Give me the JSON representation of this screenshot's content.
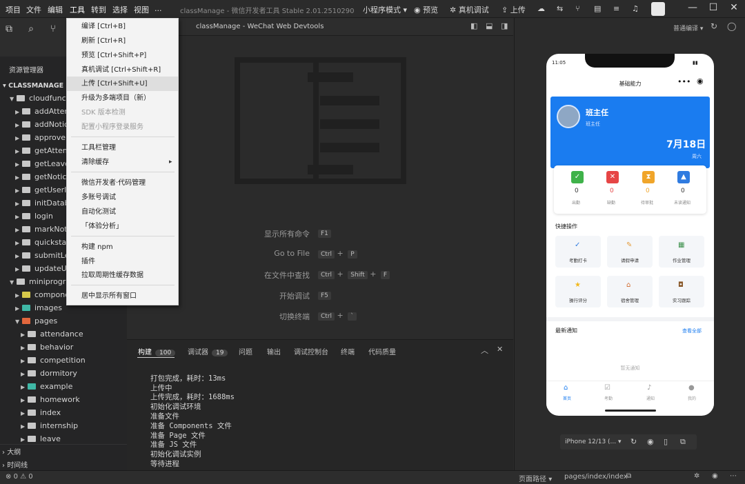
{
  "menubar": {
    "items": [
      "项目",
      "文件",
      "编辑",
      "工具",
      "转到",
      "选择",
      "视图",
      "..."
    ],
    "window_title": "classManage - 微信开发者工具 Stable 2.01.2510290"
  },
  "toolbar": {
    "mode": "小程序模式",
    "preview": "预览",
    "real_debug": "真机调试",
    "upload": "上传"
  },
  "dropdown": {
    "items": [
      {
        "label": "编译  [Ctrl+B]"
      },
      {
        "label": "刷新  [Ctrl+R]"
      },
      {
        "label": "预览  [Ctrl+Shift+P]"
      },
      {
        "label": "真机调试  [Ctrl+Shift+R]"
      },
      {
        "label": "上传  [Ctrl+Shift+U]"
      },
      {
        "label": "升级为多端项目（新）"
      },
      {
        "label": "SDK 版本检测"
      },
      {
        "label": "配置小程序登录服务"
      },
      {
        "label": "工具栏管理"
      },
      {
        "label": "清除缓存"
      },
      {
        "label": "微信开发者·代码管理"
      },
      {
        "label": "多账号调试"
      },
      {
        "label": "自动化测试"
      },
      {
        "label": "「体验分析」"
      },
      {
        "label": "构建 npm"
      },
      {
        "label": "插件"
      },
      {
        "label": "拉取周期性缓存数据"
      },
      {
        "label": "居中显示所有窗口"
      }
    ],
    "submenu_arrow": "▸"
  },
  "explorer": {
    "title": "资源管理器",
    "root": "CLASSMANAGE",
    "rows": [
      {
        "label": "cloudfunct"
      },
      {
        "label": "addAtten"
      },
      {
        "label": "addNotic"
      },
      {
        "label": "approveL"
      },
      {
        "label": "getAtten"
      },
      {
        "label": "getLeave"
      },
      {
        "label": "getNotic"
      },
      {
        "label": "getUserIn"
      },
      {
        "label": "initDatab"
      },
      {
        "label": "login"
      },
      {
        "label": "markNot"
      },
      {
        "label": "quickstar"
      },
      {
        "label": "submitLe"
      },
      {
        "label": "updateUs"
      },
      {
        "label": "miniprogra"
      },
      {
        "label": "compone"
      },
      {
        "label": "images"
      },
      {
        "label": "pages"
      },
      {
        "label": "attendance"
      },
      {
        "label": "behavior"
      },
      {
        "label": "competition"
      },
      {
        "label": "dormitory"
      },
      {
        "label": "example"
      },
      {
        "label": "homework"
      },
      {
        "label": "index"
      },
      {
        "label": "internship"
      },
      {
        "label": "leave"
      }
    ],
    "outline": "大纲",
    "timeline": "时间线"
  },
  "editor": {
    "title": "classManage - WeChat Web Devtools",
    "shortcuts": [
      {
        "label": "显示所有命令",
        "keys": [
          "F1"
        ]
      },
      {
        "label": "Go to File",
        "keys": [
          "Ctrl",
          "+",
          "P"
        ]
      },
      {
        "label": "在文件中查找",
        "keys": [
          "Ctrl",
          "+",
          "Shift",
          "+",
          "F"
        ]
      },
      {
        "label": "开始调试",
        "keys": [
          "F5"
        ]
      },
      {
        "label": "切换终端",
        "keys": [
          "Ctrl",
          "+",
          "`"
        ]
      }
    ]
  },
  "panel": {
    "tabs": [
      {
        "label": "构建",
        "badge": "100"
      },
      {
        "label": "调试器",
        "badge": "19"
      },
      {
        "label": "问题"
      },
      {
        "label": "输出"
      },
      {
        "label": "调试控制台"
      },
      {
        "label": "终端"
      },
      {
        "label": "代码质量"
      }
    ],
    "log": [
      "打包完成，耗时：13ms",
      "上传中",
      "上传完成，耗时：1688ms",
      "初始化调试环境",
      "准备文件",
      "准备 Components 文件",
      "准备 Page 文件",
      "准备 JS 文件",
      "初始化调试实例",
      "等待进程"
    ]
  },
  "simulator": {
    "compile_mode": "普通编译",
    "device": "iPhone 12/13 (...",
    "phone": {
      "time": "11:05",
      "nav_title": "基础能力",
      "role": "班主任",
      "role_sub": "班主任",
      "date": "7月18日",
      "weekday": "周六",
      "stats": [
        {
          "value": "0",
          "label": "出勤",
          "color": "#3fb24a",
          "count_color": "#333"
        },
        {
          "value": "0",
          "label": "缺勤",
          "color": "#e64545",
          "count_color": "#e64545"
        },
        {
          "value": "0",
          "label": "待审批",
          "color": "#f0a52a",
          "count_color": "#f0a52a"
        },
        {
          "value": "0",
          "label": "未读通知",
          "color": "#2f7be0",
          "count_color": "#333"
        }
      ],
      "quick_title": "快捷操作",
      "quick": [
        {
          "label": "考勤打卡"
        },
        {
          "label": "请假申请"
        },
        {
          "label": "作业管理"
        },
        {
          "label": "操行评分"
        },
        {
          "label": "宿舍管理"
        },
        {
          "label": "实习跟踪"
        }
      ],
      "notice_title": "最新通知",
      "notice_more": "查看全部",
      "notice_empty": "暂无通知",
      "tabs": [
        "首页",
        "考勤",
        "通知",
        "我的"
      ]
    }
  },
  "statusbar": {
    "errors": "0",
    "warnings": "0",
    "path_label": "页面路径",
    "path": "pages/index/index"
  },
  "colors": {
    "accent": "#1a7cf0",
    "badge": "#444444"
  }
}
